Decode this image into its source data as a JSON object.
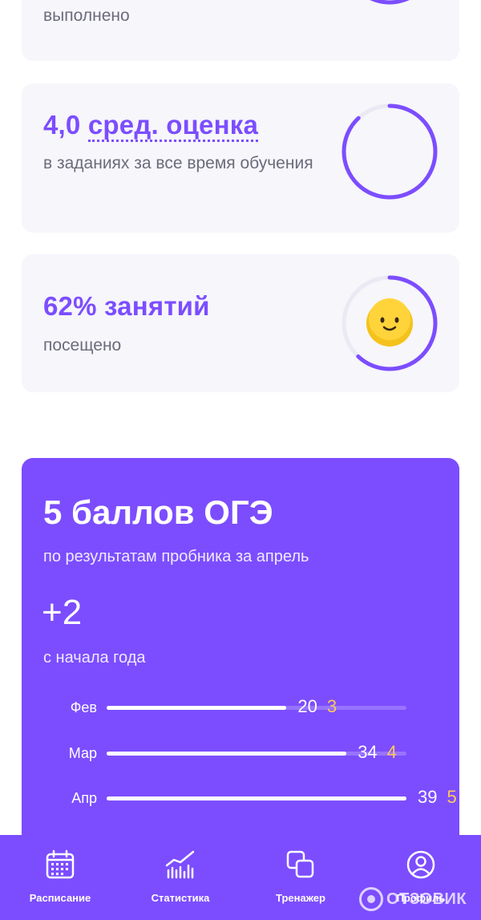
{
  "cards": {
    "tasks": {
      "subtitle": "выполнено"
    },
    "grade": {
      "value": "4,0",
      "label": "сред. оценка",
      "subtitle": "в заданиях за все время обучения",
      "ring_fill_fraction": 0.88
    },
    "attendance": {
      "value": "62% занятий",
      "subtitle": "посещено",
      "ring_fill_fraction": 0.62
    }
  },
  "exam": {
    "title": "5 баллов ОГЭ",
    "subtitle": "по результатам пробника за апрель",
    "delta": "+2",
    "since": "с начала года",
    "bars": [
      {
        "month": "Фев",
        "points": "20",
        "grade": "3",
        "fill_fraction": 0.6
      },
      {
        "month": "Мар",
        "points": "34",
        "grade": "4",
        "fill_fraction": 0.8
      },
      {
        "month": "Апр",
        "points": "39",
        "grade": "5",
        "fill_fraction": 1.0
      }
    ]
  },
  "nav": {
    "items": [
      {
        "label": "Расписание",
        "icon": "calendar-icon"
      },
      {
        "label": "Статистика",
        "icon": "chart-icon"
      },
      {
        "label": "Тренажер",
        "icon": "copy-icon"
      },
      {
        "label": "Профиль",
        "icon": "user-icon"
      }
    ]
  },
  "watermark": {
    "text": "ОТЗОВИК"
  },
  "colors": {
    "accent": "#7c4dff",
    "card_bg": "#f6f6fb",
    "grade_highlight": "#ffc85a",
    "emoji": "#f5c21c"
  }
}
